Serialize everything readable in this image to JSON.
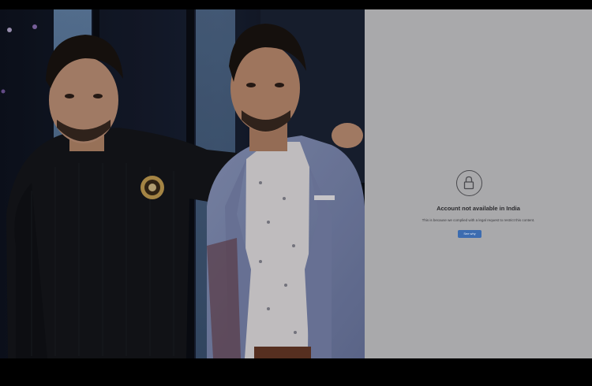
{
  "blocked_notice": {
    "title": "Account not available in India",
    "description": "This is because we complied with a legal request to restrict this content.",
    "button_label": "See why",
    "lock_icon": "lock-icon",
    "accent_color": "#3c6cb0",
    "panel_color": "#a9a9ab"
  },
  "photo": {
    "description_icon": "photo"
  }
}
